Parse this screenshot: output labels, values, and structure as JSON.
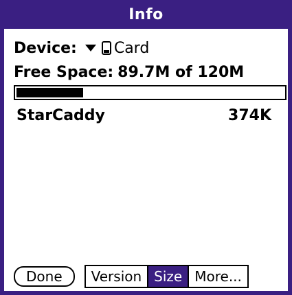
{
  "title": "Info",
  "device": {
    "label": "Device:",
    "selected": "Card",
    "dropdown_icon": "triangle-down-icon",
    "card_icon": "card-icon"
  },
  "free_space": {
    "label": "Free Space:",
    "value": "89.7M of 120M",
    "used_fraction": 0.25
  },
  "apps": [
    {
      "name": "StarCaddy",
      "size": "374K"
    }
  ],
  "buttons": {
    "done": "Done",
    "tabs": [
      {
        "label": "Version",
        "selected": false
      },
      {
        "label": "Size",
        "selected": true
      },
      {
        "label": "More...",
        "selected": false
      }
    ]
  },
  "colors": {
    "accent": "#3a1f82"
  }
}
